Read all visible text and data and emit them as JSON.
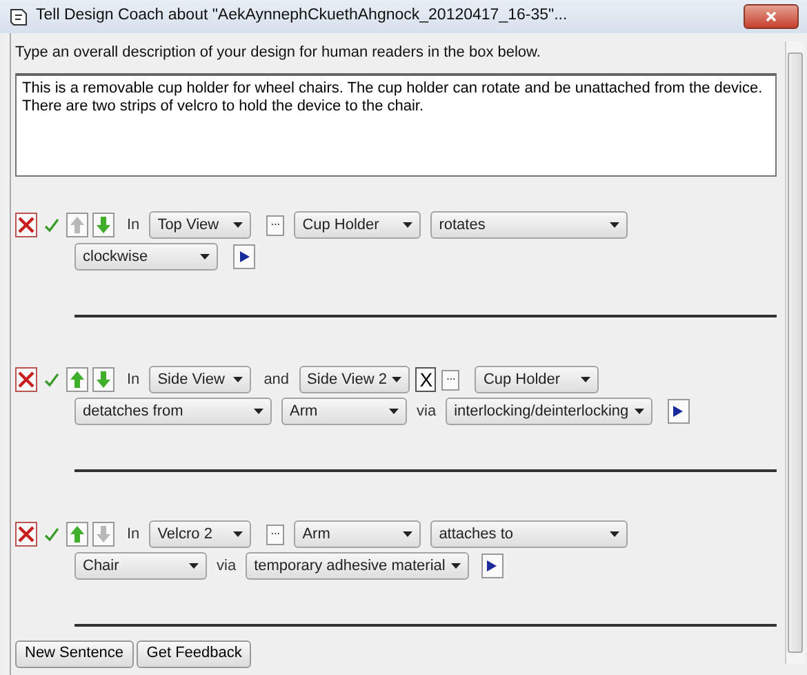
{
  "window": {
    "title": "Tell Design Coach about \"AekAynnephCkuethAhgnock_20120417_16-35\"..."
  },
  "instruction": "Type an overall description of your design for human readers in the box below.",
  "description": "This is a removable cup holder for wheel chairs. The cup holder can rotate and be unattached from the device. There are two strips of velcro to hold the device to the chair.",
  "sentences": [
    {
      "up_enabled": false,
      "down_enabled": true,
      "lines": [
        [
          {
            "kind": "word",
            "text": "In"
          },
          {
            "kind": "dropdown",
            "text": "Top View"
          },
          {
            "kind": "ellipsis",
            "text": "..."
          },
          {
            "kind": "dropdown",
            "text": "Cup Holder"
          },
          {
            "kind": "dropdown",
            "text": "rotates"
          }
        ],
        [
          {
            "kind": "dropdown",
            "text": "clockwise"
          },
          {
            "kind": "play"
          }
        ]
      ]
    },
    {
      "up_enabled": true,
      "down_enabled": true,
      "lines": [
        [
          {
            "kind": "word",
            "text": "In"
          },
          {
            "kind": "dropdown",
            "text": "Side View"
          },
          {
            "kind": "word",
            "text": "and"
          },
          {
            "kind": "dropdown",
            "text": "Side View 2"
          },
          {
            "kind": "remove",
            "text": "X"
          },
          {
            "kind": "ellipsis",
            "text": "..."
          },
          {
            "kind": "dropdown",
            "text": "Cup Holder"
          }
        ],
        [
          {
            "kind": "dropdown",
            "text": "detatches from"
          },
          {
            "kind": "dropdown",
            "text": "Arm"
          },
          {
            "kind": "word",
            "text": "via"
          },
          {
            "kind": "dropdown",
            "text": "interlocking/deinterlocking"
          },
          {
            "kind": "play"
          }
        ]
      ]
    },
    {
      "up_enabled": true,
      "down_enabled": false,
      "lines": [
        [
          {
            "kind": "word",
            "text": "In"
          },
          {
            "kind": "dropdown",
            "text": "Velcro 2"
          },
          {
            "kind": "ellipsis",
            "text": "..."
          },
          {
            "kind": "dropdown",
            "text": "Arm"
          },
          {
            "kind": "dropdown",
            "text": "attaches to"
          }
        ],
        [
          {
            "kind": "dropdown",
            "text": "Chair"
          },
          {
            "kind": "word",
            "text": "via"
          },
          {
            "kind": "dropdown",
            "text": "temporary adhesive material"
          },
          {
            "kind": "play"
          }
        ]
      ]
    }
  ],
  "buttons": [
    "New Sentence",
    "Get Feedback"
  ]
}
